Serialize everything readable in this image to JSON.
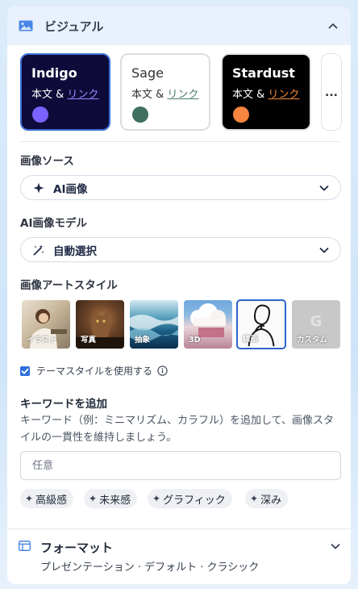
{
  "header": {
    "title": "ビジュアル"
  },
  "themes": [
    {
      "name": "Indigo",
      "body": "本文 &",
      "link": "リンク",
      "dot_color": "#7b61ff",
      "selected": true
    },
    {
      "name": "Sage",
      "body": "本文 &",
      "link": "リンク",
      "dot_color": "#3f6f5f",
      "selected": false
    },
    {
      "name": "Stardust",
      "body": "本文 &",
      "link": "リンク",
      "dot_color": "#f5853f",
      "selected": false
    }
  ],
  "more_label": "...",
  "image_source": {
    "label": "画像ソース",
    "value": "AI画像"
  },
  "image_model": {
    "label": "AI画像モデル",
    "value": "自動選択"
  },
  "art_style": {
    "label": "画像アートスタイル",
    "options": [
      "イラスト",
      "写真",
      "抽象",
      "3D",
      "線画",
      "カスタム"
    ],
    "selected": "線画"
  },
  "theme_style_checkbox": {
    "label": "テーマスタイルを使用する",
    "checked": true
  },
  "keywords": {
    "title": "キーワードを追加",
    "description": "キーワード（例：ミニマリズム、カラフル）を追加して、画像スタイルの一貫性を維持しましょう。",
    "placeholder": "任意",
    "chips": [
      "高級感",
      "未来感",
      "グラフィック",
      "深み"
    ]
  },
  "format": {
    "title": "フォーマット",
    "subtitle": "プレゼンテーション · デフォルト · クラシック"
  },
  "colors": {
    "accent": "#2f6fdd",
    "header_bg": "#e9f1fc"
  }
}
